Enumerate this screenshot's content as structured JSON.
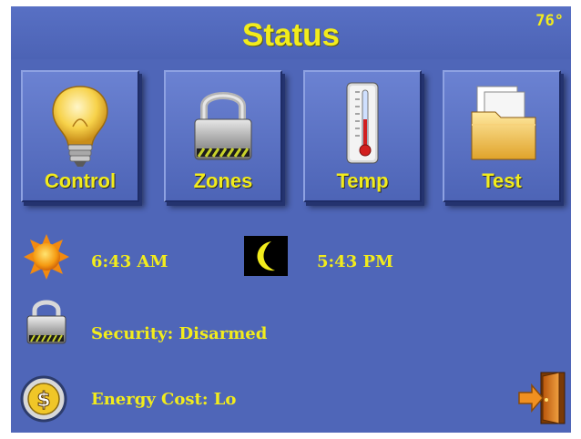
{
  "header": {
    "title": "Status",
    "temperature": "76°"
  },
  "tiles": [
    {
      "label": "Control",
      "icon": "lightbulb-icon"
    },
    {
      "label": "Zones",
      "icon": "padlock-icon"
    },
    {
      "label": "Temp",
      "icon": "thermometer-icon"
    },
    {
      "label": "Test",
      "icon": "folder-icon"
    }
  ],
  "sun": {
    "sunrise": "6:43 AM",
    "sunset": "5:43 PM",
    "sunrise_icon": "sun-icon",
    "sunset_icon": "moon-icon"
  },
  "security": {
    "text": "Security: Disarmed",
    "icon": "padlock-icon"
  },
  "energy": {
    "text": "Energy Cost: Lo",
    "icon": "dollar-coin-icon"
  },
  "exit_icon": "exit-door-icon",
  "colors": {
    "background": "#4f66b8",
    "accent_text": "#f2ec1c",
    "tile_face": "#5a71c3"
  }
}
